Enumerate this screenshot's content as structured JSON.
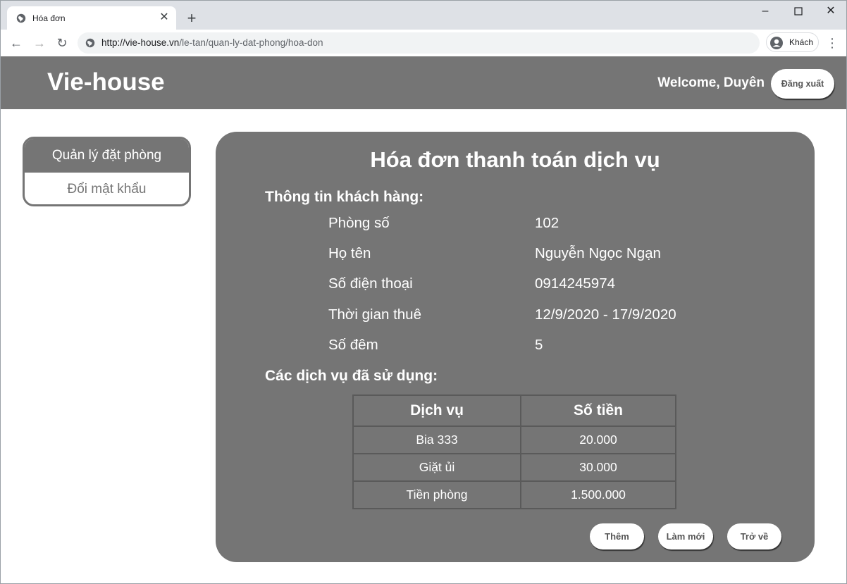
{
  "browser": {
    "tab_title": "Hóa đơn",
    "url_host": "http://vie-house.vn",
    "url_path": "/le-tan/quan-ly-dat-phong/hoa-don",
    "profile_label": "Khách"
  },
  "header": {
    "brand": "Vie-house",
    "welcome": "Welcome, Duyên",
    "logout_label": "Đăng xuất"
  },
  "sidebar": {
    "items": [
      {
        "label": "Quản lý đặt phòng"
      },
      {
        "label": "Đổi mật khẩu"
      }
    ]
  },
  "invoice": {
    "title": "Hóa đơn thanh toán dịch vụ",
    "customer_section": "Thông tin khách hàng:",
    "fields": [
      {
        "label": "Phòng số",
        "value": "102"
      },
      {
        "label": "Họ tên",
        "value": "Nguyễn Ngọc Ngạn"
      },
      {
        "label": "Số điện thoại",
        "value": "0914245974"
      },
      {
        "label": "Thời gian thuê",
        "value": "12/9/2020 - 17/9/2020"
      },
      {
        "label": "Số đêm",
        "value": "5"
      }
    ],
    "services_section": "Các dịch vụ đã sử dụng:",
    "table": {
      "headers": [
        "Dịch vụ",
        "Số tiền"
      ],
      "rows": [
        [
          "Bia 333",
          "20.000"
        ],
        [
          "Giặt ủi",
          "30.000"
        ],
        [
          "Tiền phòng",
          "1.500.000"
        ]
      ]
    },
    "buttons": {
      "add": "Thêm",
      "refresh": "Làm mới",
      "back": "Trở về"
    }
  },
  "colors": {
    "accent_gray": "#757575",
    "chrome_bg": "#dee1e6"
  }
}
